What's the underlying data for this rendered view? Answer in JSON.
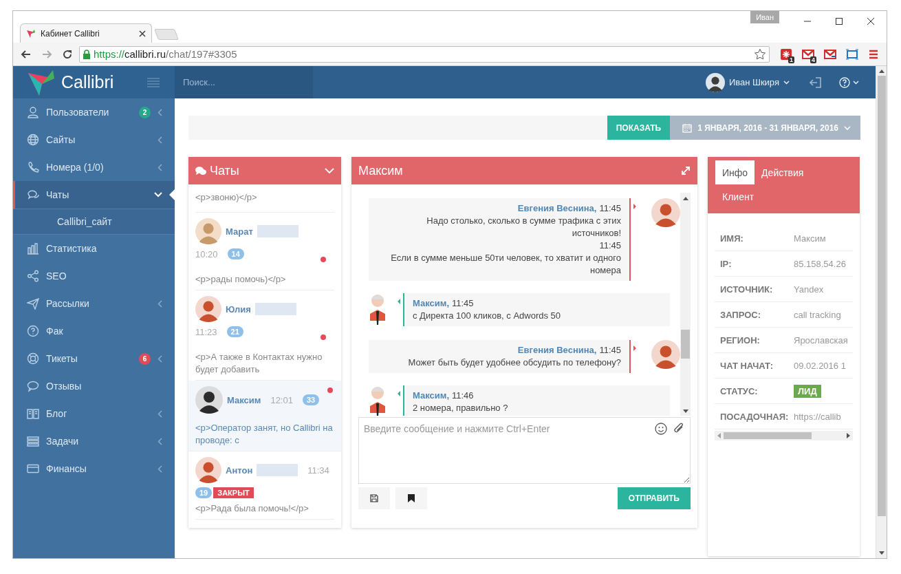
{
  "browser": {
    "tab": {
      "title": "Кабинет Callibri"
    },
    "profile": "Иван",
    "url": {
      "scheme": "https://",
      "host": "callibri.ru",
      "path": "/chat/197#3305"
    },
    "extension_badges": [
      "1",
      "4"
    ]
  },
  "topbar": {
    "brand": "Callibri",
    "search": {
      "placeholder": "Поиск..."
    },
    "user": "Иван Шкиря"
  },
  "sidebar": {
    "items": [
      {
        "label": "Пользователи",
        "badge": "2",
        "color": "#26a98b",
        "expandable": true,
        "expanded": false,
        "selected": false
      },
      {
        "label": "Сайты",
        "expandable": true,
        "expanded": false,
        "selected": false
      },
      {
        "label": "Номера (1/0)",
        "expandable": true,
        "expanded": false,
        "selected": false
      },
      {
        "label": "Чаты",
        "expandable": true,
        "expanded": true,
        "selected": true,
        "children": [
          {
            "label": "Callibri_сайт"
          }
        ]
      },
      {
        "label": "Статистика",
        "expandable": false,
        "selected": false
      },
      {
        "label": "SEO",
        "expandable": false,
        "selected": false
      },
      {
        "label": "Рассылки",
        "expandable": true,
        "expanded": false,
        "selected": false
      },
      {
        "label": "Фак",
        "expandable": false,
        "selected": false
      },
      {
        "label": "Тикеты",
        "badge": "6",
        "color": "#e04b55",
        "expandable": true,
        "expanded": false,
        "selected": false
      },
      {
        "label": "Отзывы",
        "expandable": false,
        "selected": false
      },
      {
        "label": "Блог",
        "expandable": true,
        "expanded": false,
        "selected": false
      },
      {
        "label": "Задачи",
        "expandable": true,
        "expanded": false,
        "selected": false
      },
      {
        "label": "Финансы",
        "expandable": true,
        "expanded": false,
        "selected": false
      }
    ]
  },
  "filter": {
    "show_button": "ПОКАЗАТЬ",
    "date_range": "1 ЯНВАРЯ, 2016 - 31 ЯНВАРЯ, 2016"
  },
  "chats": {
    "title": "Чаты",
    "items": [
      {
        "kind": "fragment",
        "preview": "<p>звоню)</p>",
        "selected": false
      },
      {
        "kind": "stacked",
        "name": "Марат",
        "time": "10:20",
        "count": "14",
        "unread": true,
        "selected": false,
        "preview": "<p>рады помочь)</p>"
      },
      {
        "kind": "stacked",
        "name": "Юлия",
        "time": "11:23",
        "count": "21",
        "unread": true,
        "selected": false,
        "preview": "<p>А также в Контактах нужно будет добавить"
      },
      {
        "kind": "inline",
        "name": "Максим",
        "time": "12:01",
        "count": "33",
        "unread": true,
        "selected": true,
        "preview": "<p>Оператор занят, но Callibri на проводе: с"
      },
      {
        "kind": "inline",
        "name": "Антон",
        "time": "11:34",
        "count": "19",
        "status": "ЗАКРЫТ",
        "unread": false,
        "selected": false,
        "preview": "<p>Рада была помочь!</p>"
      }
    ]
  },
  "conversation": {
    "title": "Максим",
    "messages": [
      {
        "kind": "operator",
        "author": "Евгения Веснина,",
        "parts": [
          {
            "time": "11:45",
            "text": "Надо столько, сколько в сумме трафика с этих источников!"
          },
          {
            "time": "11:45",
            "text": "Если в сумме меньше 50ти человек, то хватит и одного номера"
          }
        ]
      },
      {
        "kind": "client",
        "author": "Максим,",
        "parts": [
          {
            "time": "11:45",
            "text": "с Директа 100 кликов, с Adwords 50"
          }
        ]
      },
      {
        "kind": "operator",
        "author": "Евгения Веснина,",
        "parts": [
          {
            "time": "11:45",
            "text": "Может быть будет удобнее обсудить по телефону?"
          }
        ]
      },
      {
        "kind": "client",
        "author": "Максим,",
        "parts": [
          {
            "time": "11:46",
            "text": "2 номера, правильно ?"
          }
        ]
      }
    ],
    "input": {
      "placeholder": "Введите сообщение и нажмите Ctrl+Enter"
    },
    "send_button": "ОТПРАВИТЬ"
  },
  "client": {
    "tabs": [
      {
        "label": "Инфо",
        "selected": true
      },
      {
        "label": "Действия",
        "selected": false
      },
      {
        "label": "Клиент",
        "selected": false
      }
    ],
    "fields": [
      {
        "label": "ИМЯ:",
        "value": "Максим",
        "kind": "text"
      },
      {
        "label": "IP:",
        "value": "85.158.54.26",
        "kind": "text"
      },
      {
        "label": "ИСТОЧНИК:",
        "value": "Yandex",
        "kind": "text"
      },
      {
        "label": "ЗАПРОС:",
        "value": "call tracking",
        "kind": "text"
      },
      {
        "label": "РЕГИОН:",
        "value": "Ярославская",
        "kind": "text"
      },
      {
        "label": "ЧАТ НАЧАТ:",
        "value": "09.02.2016 1",
        "kind": "text"
      },
      {
        "label": "СТАТУС:",
        "value": "ЛИД",
        "kind": "badge"
      },
      {
        "label": "ПОСАДОЧНАЯ:",
        "value": "https://callib",
        "kind": "text"
      }
    ]
  }
}
